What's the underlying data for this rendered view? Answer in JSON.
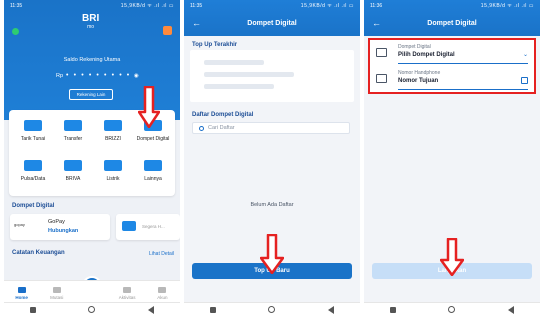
{
  "status": {
    "time": "11:35",
    "time2": "11:35",
    "time3": "11:36",
    "icons": "15,9KB/d ᯤ .ıl .ıl ▭"
  },
  "screen1": {
    "logo_main": "BRI",
    "logo_sub": "mo",
    "saldo_label": "Saldo Rekening Utama",
    "saldo_prefix": "Rp",
    "saldo_mask": "• • • • • • • • •",
    "rekening_button": "Rekening Lain",
    "menus": [
      {
        "label": "Tarik Tunai",
        "color": "#1e88e5"
      },
      {
        "label": "Transfer",
        "color": "#1e88e5"
      },
      {
        "label": "BRIZZI",
        "color": "#1e88e5"
      },
      {
        "label": "Dompet Digital",
        "color": "#1e88e5"
      },
      {
        "label": "Pulsa/Data",
        "color": "#1e88e5"
      },
      {
        "label": "BRIVA",
        "color": "#1e88e5"
      },
      {
        "label": "Listrik",
        "color": "#1e88e5"
      },
      {
        "label": "Lainnya",
        "color": "#1e88e5"
      }
    ],
    "section_dompet": "Dompet Digital",
    "gopay_name": "GoPay",
    "gopay_action": "Hubungkan",
    "gopay_logo": "gopay",
    "segera_text": "Segera H...",
    "section_catatan": "Catatan Keuangan",
    "lihat_detail": "Lihat Detail",
    "tabs": [
      {
        "label": "Home"
      },
      {
        "label": "Mutasi"
      },
      {
        "label": "QRIS"
      },
      {
        "label": "Aktivitas"
      },
      {
        "label": "Akun"
      }
    ]
  },
  "screen2": {
    "title": "Dompet Digital",
    "topup_title": "Top Up Terakhir",
    "daftar_title": "Daftar Dompet Digital",
    "search_placeholder": "Cari Daftar",
    "empty_text": "Belum Ada Daftar",
    "button": "Top Up Baru"
  },
  "screen3": {
    "title": "Dompet Digital",
    "field1_label": "Dompet Digital",
    "field1_value": "Pilih Dompet Digital",
    "field2_label": "Nomor Handphone",
    "field2_value": "Nomor Tujuan",
    "button": "Lanjutkan"
  },
  "colors": {
    "primary": "#1a73c8",
    "accent_red": "#e52121",
    "disabled": "#c6def7"
  }
}
